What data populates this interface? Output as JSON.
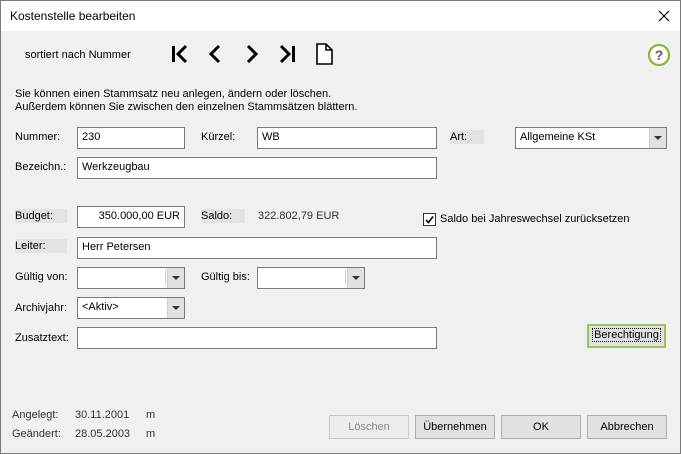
{
  "window": {
    "title": "Kostenstelle bearbeiten"
  },
  "toolbar": {
    "sort_label": "sortiert nach Nummer",
    "nav_icons": [
      "first-record-icon",
      "previous-record-icon",
      "next-record-icon",
      "last-record-icon",
      "new-document-icon"
    ],
    "help_icon": "help-icon",
    "help_color": "#8cb43c"
  },
  "info": {
    "line1": "Sie können einen Stammsatz neu anlegen, ändern oder löschen.",
    "line2": "Außerdem können Sie zwischen den einzelnen Stammsätzen blättern."
  },
  "form": {
    "nummer": {
      "label": "Nummer:",
      "value": "230"
    },
    "kuerzel": {
      "label": "Kürzel:",
      "value": "WB"
    },
    "art": {
      "label": "Art:",
      "value": "Allgemeine KSt"
    },
    "bezeichnung": {
      "label": "Bezeichn.:",
      "value": "Werkzeugbau"
    },
    "budget": {
      "label": "Budget:",
      "value": "350.000,00 EUR"
    },
    "saldo": {
      "label": "Saldo:",
      "value": "322.802,79 EUR"
    },
    "saldo_reset": {
      "label": "Saldo bei Jahreswechsel zurücksetzen",
      "checked": true
    },
    "leiter": {
      "label": "Leiter:",
      "value": "Herr Petersen"
    },
    "gueltig_von": {
      "label": "Gültig von:",
      "value": ""
    },
    "gueltig_bis": {
      "label": "Gültig bis:",
      "value": ""
    },
    "archivjahr": {
      "label": "Archivjahr:",
      "value": "<Aktiv>"
    },
    "zusatztext": {
      "label": "Zusatztext:",
      "value": ""
    }
  },
  "buttons": {
    "berechtigung": "Berechtigung",
    "loeschen": "Löschen",
    "uebernehmen": "Übernehmen",
    "ok": "OK",
    "abbrechen": "Abbrechen"
  },
  "meta": {
    "angelegt_label": "Angelegt:",
    "angelegt_date": "30.11.2001",
    "angelegt_user": "m",
    "geaendert_label": "Geändert:",
    "geaendert_date": "28.05.2003",
    "geaendert_user": "m"
  }
}
